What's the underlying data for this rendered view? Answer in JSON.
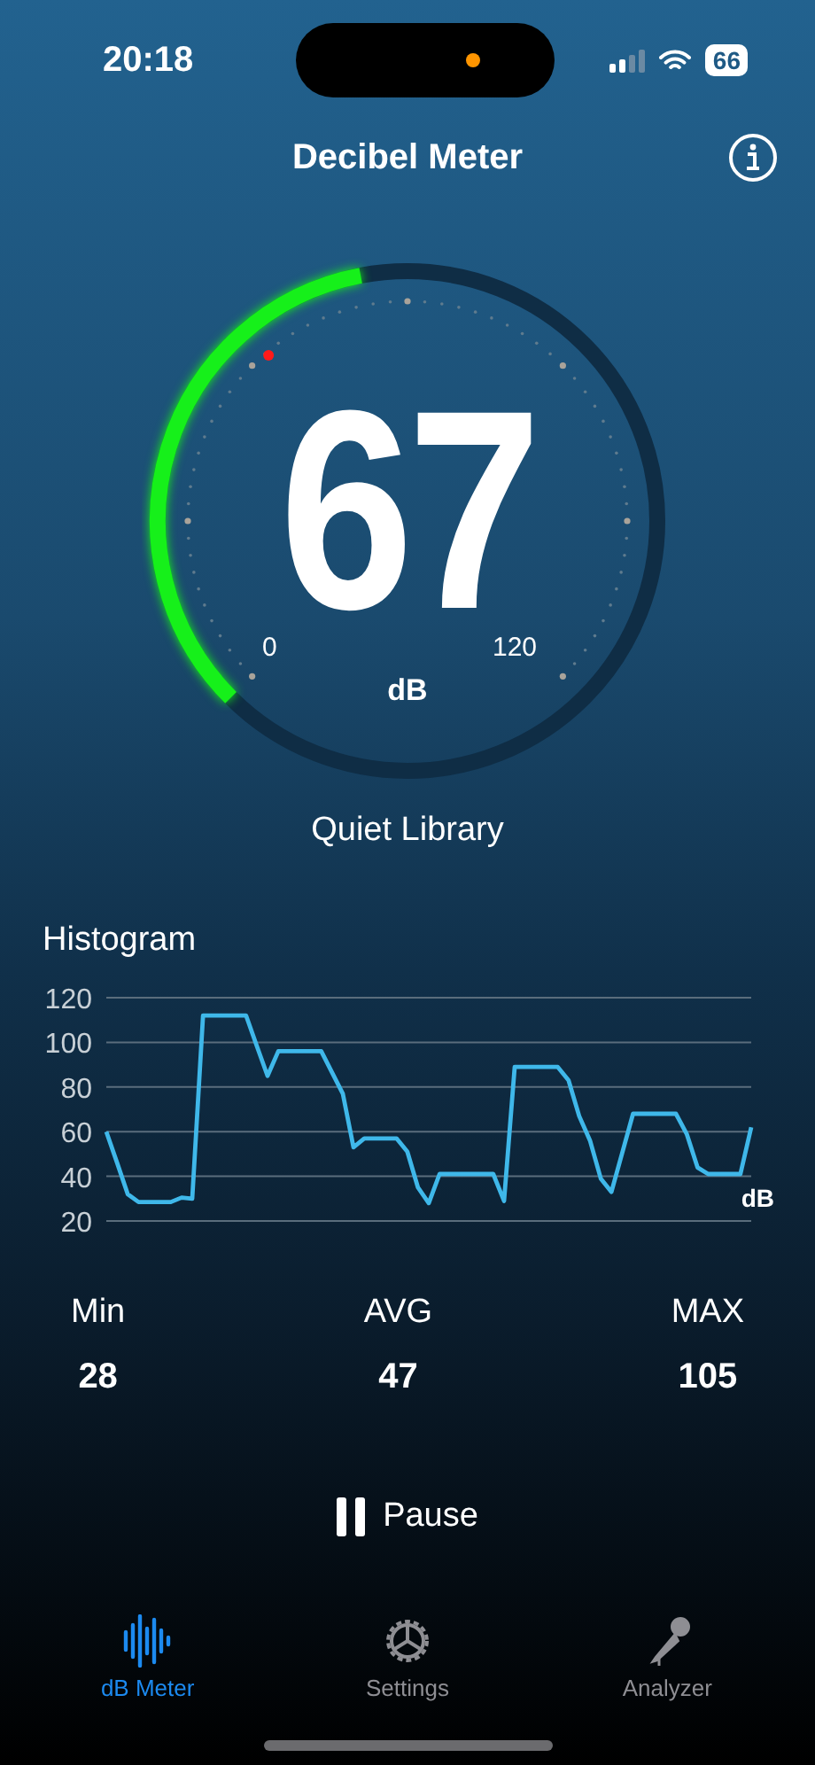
{
  "status_bar": {
    "time": "20:18",
    "battery": "66"
  },
  "header": {
    "title": "Decibel Meter"
  },
  "gauge": {
    "reading": "67",
    "min_label": "0",
    "max_label": "120",
    "unit": "dB"
  },
  "environment": "Quiet Library",
  "histogram": {
    "title": "Histogram",
    "chart_data": {
      "type": "line",
      "ylabel": "dB",
      "categories": [
        null,
        null,
        null,
        null,
        null,
        null,
        null,
        null,
        null,
        null,
        null,
        null,
        null,
        null,
        null,
        null,
        null,
        null,
        null,
        null,
        null,
        null,
        null,
        null,
        null,
        null,
        null,
        null,
        null,
        null,
        null,
        null,
        null,
        null,
        null,
        null,
        null,
        null,
        null,
        null,
        null,
        null,
        null,
        null,
        null,
        null,
        null,
        null,
        null,
        null,
        null,
        null,
        null,
        null,
        null,
        null,
        null,
        null,
        null,
        null,
        null
      ],
      "series": [
        {
          "color": "#3fb8ea",
          "values": [
            60,
            46,
            32,
            28.5,
            28.5,
            28.5,
            28.5,
            30.5,
            30,
            112,
            112,
            112,
            112,
            112,
            98.5,
            85,
            96,
            96,
            96,
            96,
            96,
            86.5,
            77,
            53,
            57,
            57,
            57,
            57,
            51,
            35,
            28,
            41,
            41,
            41,
            41,
            41,
            41,
            29,
            89,
            89,
            89,
            89,
            89,
            83,
            67,
            56,
            39,
            33,
            50.5,
            68,
            68,
            68,
            68,
            68,
            59,
            44,
            41,
            41,
            41,
            41,
            62
          ]
        }
      ],
      "grid": true,
      "ylim": [
        20,
        120
      ],
      "yticks": [
        20,
        40,
        60,
        80,
        100,
        120
      ]
    }
  },
  "stats": [
    {
      "label": "Min",
      "value": "28"
    },
    {
      "label": "AVG",
      "value": "47"
    },
    {
      "label": "MAX",
      "value": "105"
    }
  ],
  "pause_button": {
    "label": "Pause"
  },
  "tabs": [
    {
      "label": "dB Meter",
      "kind": "meter",
      "selected": true
    },
    {
      "label": "Settings",
      "kind": "settings",
      "selected": false
    },
    {
      "label": "Analyzer",
      "kind": "analyzer",
      "selected": false
    }
  ]
}
